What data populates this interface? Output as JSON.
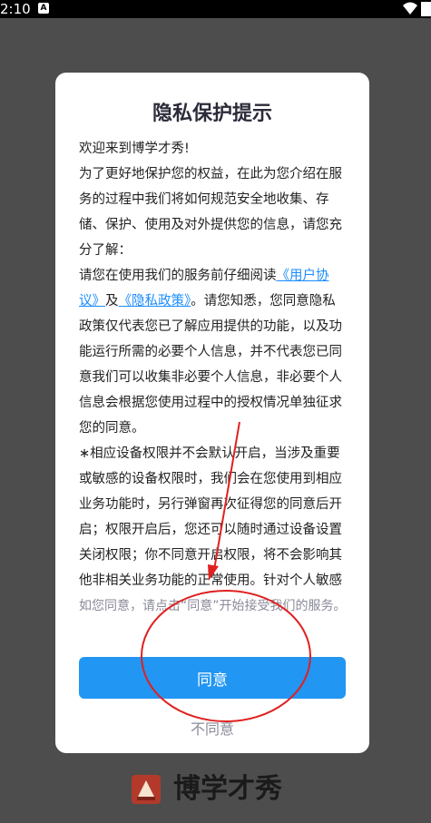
{
  "status_bar": {
    "time": "2:10",
    "badge": "A"
  },
  "dialog": {
    "title": "隐私保护提示",
    "paragraphs": {
      "p1": "欢迎来到博学才秀!",
      "p2": "为了更好地保护您的权益，在此为您介绍在服务的过程中我们将如何规范安全地收集、存储、保护、使用及对外提供您的信息，请您充分了解：",
      "p3_before": "请您在使用我们的服务前仔细阅读",
      "p3_link1": "《用户协议》",
      "p3_mid": "及",
      "p3_link2": "《隐私政策》",
      "p3_after": "。请您知悉，您同意隐私政策仅代表您已了解应用提供的功能，以及功能运行所需的必要个人信息，并不代表您已同意我们可以收集非必要个人信息，非必要个人信息会根据您使用过程中的授权情况单独征求您的同意。",
      "p4": "∗相应设备权限并不会默认开启，当涉及重要或敏感的设备权限时，我们会在您使用到相应业务功能时，另行弹窗再次征得您的同意后开启；权限开启后，您还可以随时通过设备设置关闭权限；你不同意开启权限，将不会影响其他非相关业务功能的正常使用。针对个人敏感"
    },
    "hint": "如您同意，请点击“同意”开始接受我们的服务。",
    "agree_label": "同意",
    "disagree_label": "不同意"
  },
  "brand": {
    "name": "博学才秀"
  },
  "colors": {
    "overlay": "#4d4d4d",
    "primary": "#2196f3",
    "link": "#1a8cff",
    "annotation": "#e02020"
  }
}
